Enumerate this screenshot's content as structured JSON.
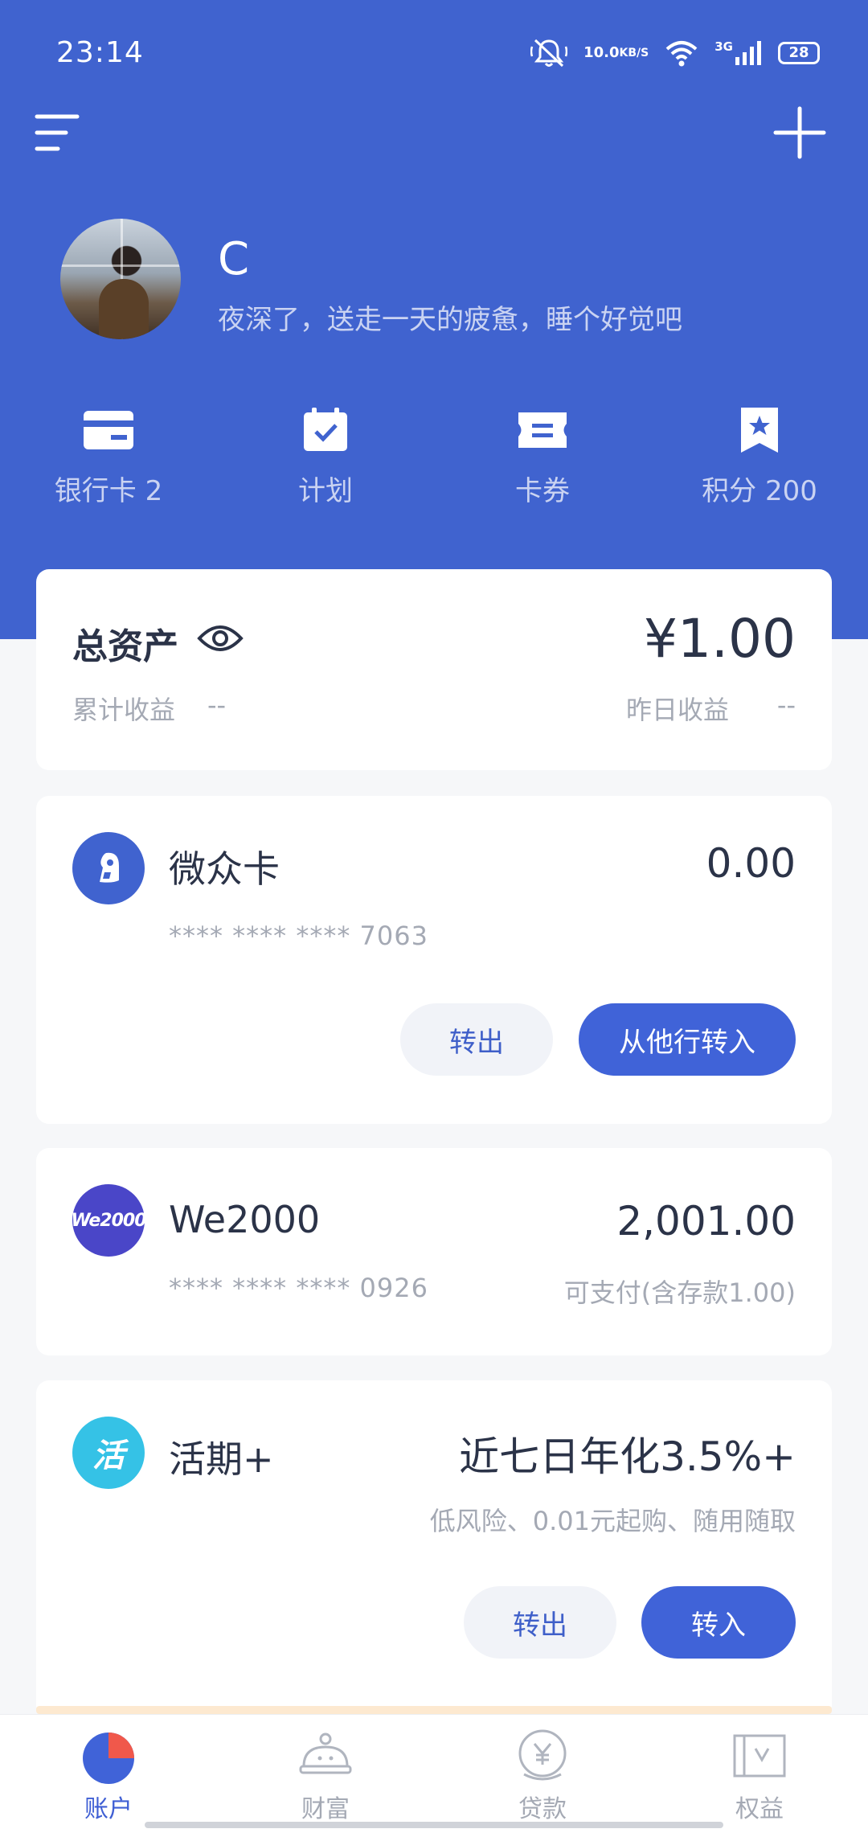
{
  "status_bar": {
    "time": "23:14",
    "net_speed_value": "10.0",
    "net_speed_unit": "KB/S",
    "signal_label": "3G",
    "battery": "28"
  },
  "profile": {
    "name": "C",
    "greeting": "夜深了，送走一天的疲惫，睡个好觉吧"
  },
  "quick_links": [
    {
      "label": "银行卡 2",
      "icon": "bank-card-icon"
    },
    {
      "label": "计划",
      "icon": "calendar-check-icon"
    },
    {
      "label": "卡券",
      "icon": "coupon-icon"
    },
    {
      "label": "积分 200",
      "icon": "bookmark-star-icon"
    }
  ],
  "total_assets": {
    "title": "总资产",
    "amount": "¥1.00",
    "cumulative_label": "累计收益",
    "cumulative_value": "--",
    "yesterday_label": "昨日收益",
    "yesterday_value": "--"
  },
  "accounts": [
    {
      "name": "微众卡",
      "number": "**** **** **** 7063",
      "amount": "0.00",
      "icon": "weizhong-card-icon",
      "buttons": {
        "out": "转出",
        "in": "从他行转入"
      }
    },
    {
      "name": "We2000",
      "number": "**** **** **** 0926",
      "amount": "2,001.00",
      "sub": "可支付(含存款1.00)",
      "icon_text": "We2000"
    },
    {
      "name": "活期+",
      "amount": "近七日年化3.5%+",
      "sub": "低风险、0.01元起购、随用随取",
      "icon_text": "活",
      "buttons": {
        "out": "转出",
        "in": "转入"
      }
    }
  ],
  "tabs": [
    {
      "label": "账户",
      "icon": "pie-chart-icon",
      "active": true
    },
    {
      "label": "财富",
      "icon": "piggy-bank-icon",
      "active": false
    },
    {
      "label": "贷款",
      "icon": "yuan-coin-icon",
      "active": false
    },
    {
      "label": "权益",
      "icon": "benefits-icon",
      "active": false
    }
  ],
  "colors": {
    "brand_blue": "#4063cf",
    "button_blue": "#4063d8",
    "text_dark": "#2b3348",
    "text_muted": "#a4a9b4",
    "we2000_purple": "#4a46c8",
    "huoqi_cyan": "#35c2e6",
    "tab_active_red": "#f0584b"
  }
}
